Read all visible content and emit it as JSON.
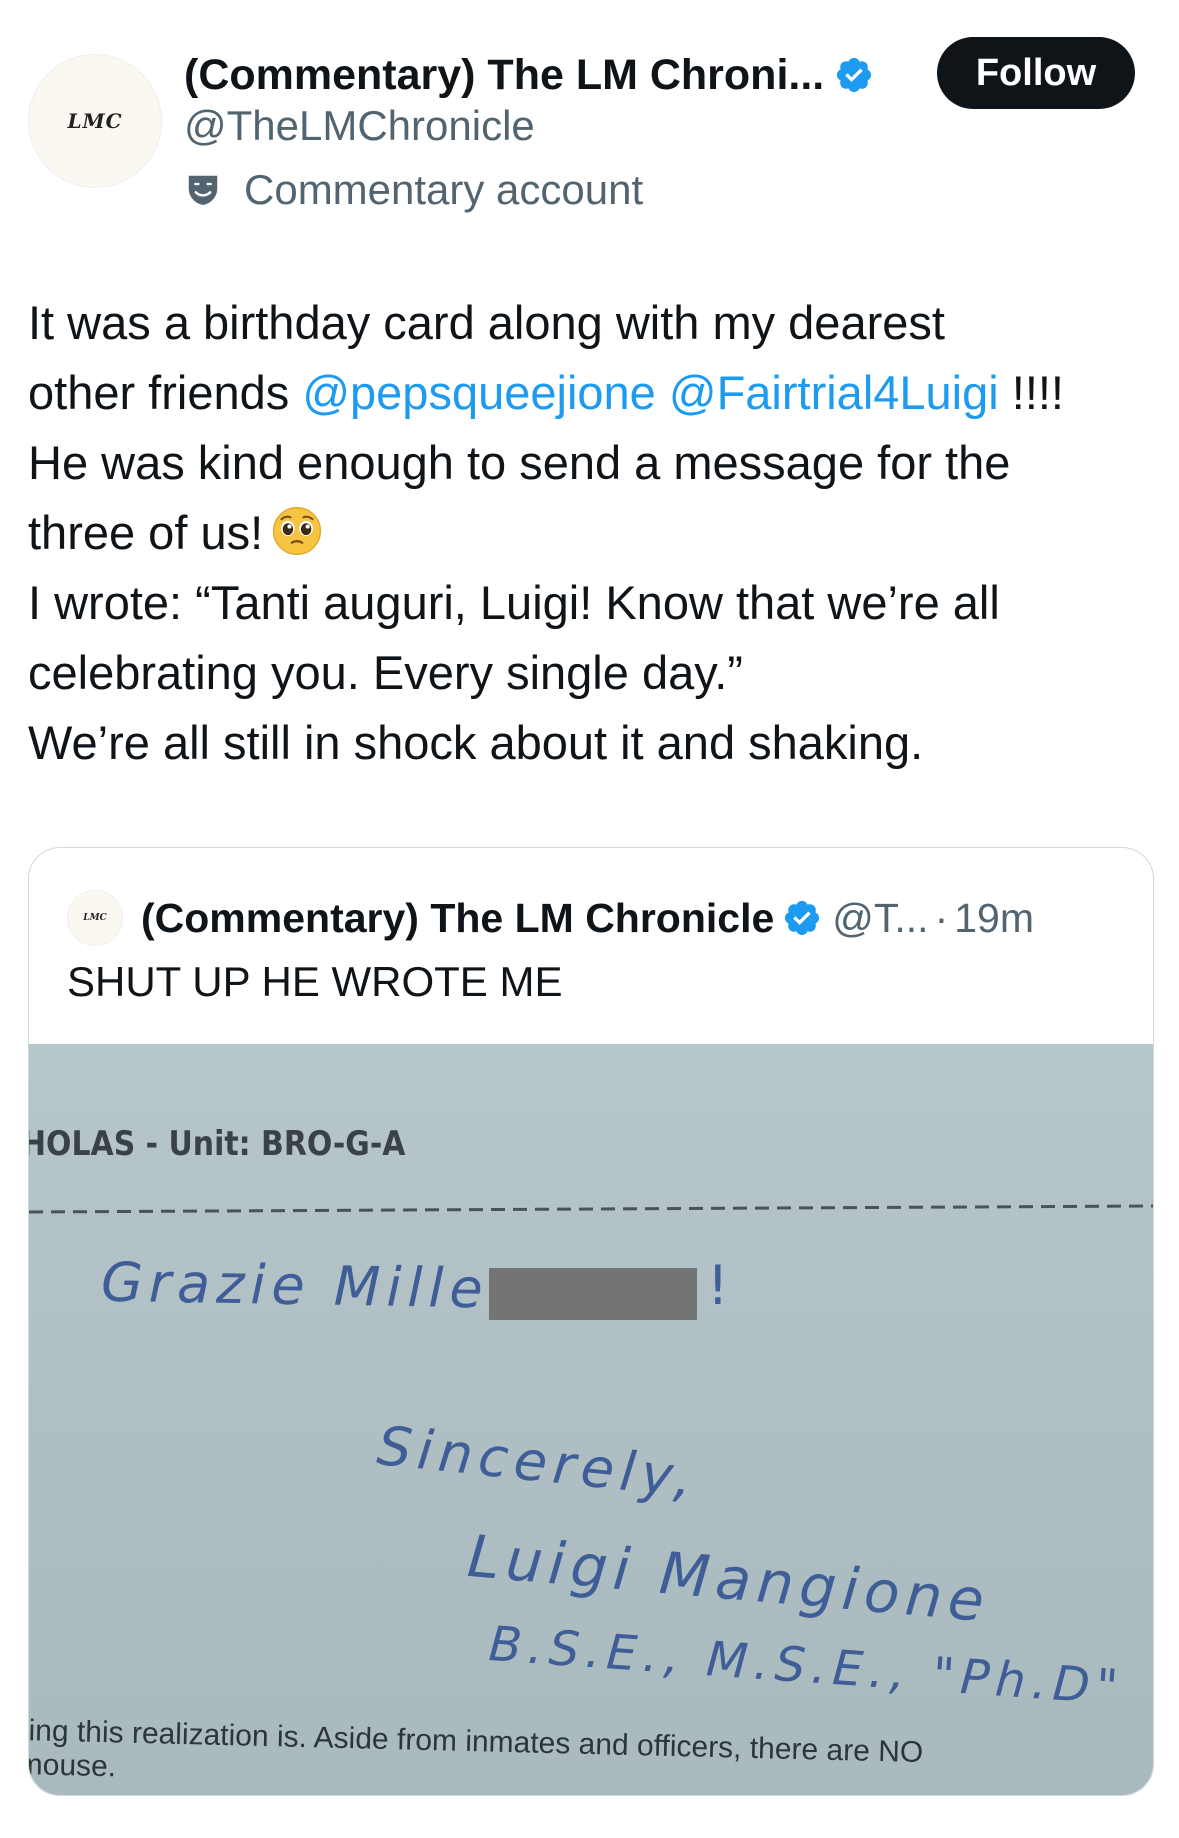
{
  "author": {
    "avatar_text": "LMC",
    "display_name": "(Commentary) The LM Chroni...",
    "handle": "@TheLMChronicle",
    "label": "Commentary account",
    "follow_label": "Follow"
  },
  "tweet": {
    "line1": "It was a birthday card along with my dearest",
    "line2_pre": "other friends ",
    "mention1": "@pepsqueejione",
    "mention2": "@Fairtrial4Luigi",
    "line2_post": " !!!!",
    "line3": "He was kind enough to send a message for the",
    "line4": "three of us!",
    "line5": "I wrote: “Tanti auguri, Luigi! Know that we’re all",
    "line6": "celebrating you. Every single day.”",
    "line7": "We’re all still in shock about it and shaking."
  },
  "quote": {
    "avatar_text": "LMC",
    "display_name": "(Commentary) The LM Chronicle",
    "handle": "@T...",
    "separator": "·",
    "time": "19m",
    "text": "SHUT UP HE WROTE ME",
    "image": {
      "printed_top": "HOLAS - Unit: BRO-G-A",
      "hand_grazie": "Grazie Mille",
      "hand_bang": "!",
      "hand_sincerely": "Sincerely,",
      "hand_name": "Luigi Mangione",
      "hand_degrees": "B.S.E., M.S.E., \"Ph.D\"",
      "printed_bottom_1": "ring this realization is. Aside from inmates and officers, there are NO",
      "printed_bottom_2": "mouse."
    }
  },
  "colors": {
    "link": "#1d9bf0",
    "text": "#0f1419",
    "secondary": "#536471",
    "verified": "#1d9bf0",
    "follow_bg": "#0f1419",
    "ink": "#3f5d96"
  },
  "icons": {
    "verified": "verified-badge-icon",
    "commentary": "theater-mask-icon",
    "emoji": "pleading-face-emoji"
  }
}
